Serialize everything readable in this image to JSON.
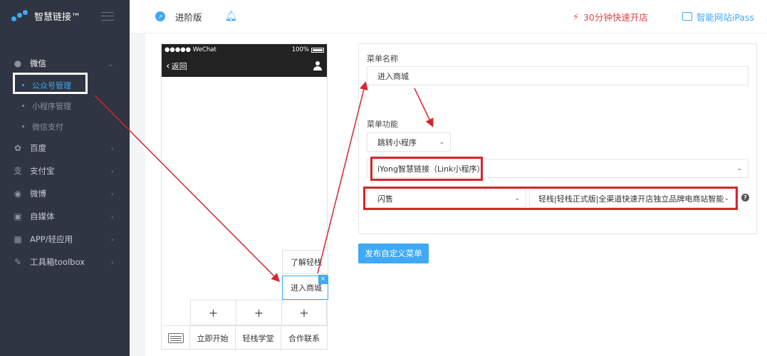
{
  "app": {
    "name": "智慧链接™"
  },
  "sidebar": {
    "items": [
      {
        "label": "微信",
        "icon": "wechat-icon"
      },
      {
        "label": "百度",
        "icon": "paw-icon"
      },
      {
        "label": "支付宝",
        "icon": "alipay-icon"
      },
      {
        "label": "微博",
        "icon": "weibo-icon"
      },
      {
        "label": "自媒体",
        "icon": "media-icon"
      },
      {
        "label": "APP/轻应用",
        "icon": "app-grid-icon"
      },
      {
        "label": "工具箱toolbox",
        "icon": "wrench-icon"
      }
    ],
    "wechat_sub": [
      {
        "label": "公众号管理"
      },
      {
        "label": "小程序管理"
      },
      {
        "label": "微信支付"
      }
    ]
  },
  "topbar": {
    "version": "进阶版",
    "quick_open": "30分钟快速开店",
    "ipass": "智能网站iPass"
  },
  "phone": {
    "carrier": "●●●●● WeChat",
    "battery": "100%",
    "back": "返回",
    "submenu": [
      "了解轻栈",
      "进入商城"
    ],
    "close": "×",
    "plus": "+",
    "tabs": [
      "立即开始",
      "轻栈学堂",
      "合作联系"
    ]
  },
  "form": {
    "name_label": "菜单名称",
    "name_value": "进入商城",
    "func_label": "菜单功能",
    "func_value": "跳转小程序",
    "miniprogram_value": "iYong智慧链接（Link小程序）",
    "page_value": "闪售",
    "shop_value": "轻栈|轻栈正式版|全渠道快速开店独立品牌电商站智能网站",
    "help": "?"
  },
  "publish_label": "发布自定义菜单",
  "colors": {
    "accent": "#3fa9f5",
    "annotation": "#d6262d",
    "sidebar_bg": "#2f3542"
  }
}
